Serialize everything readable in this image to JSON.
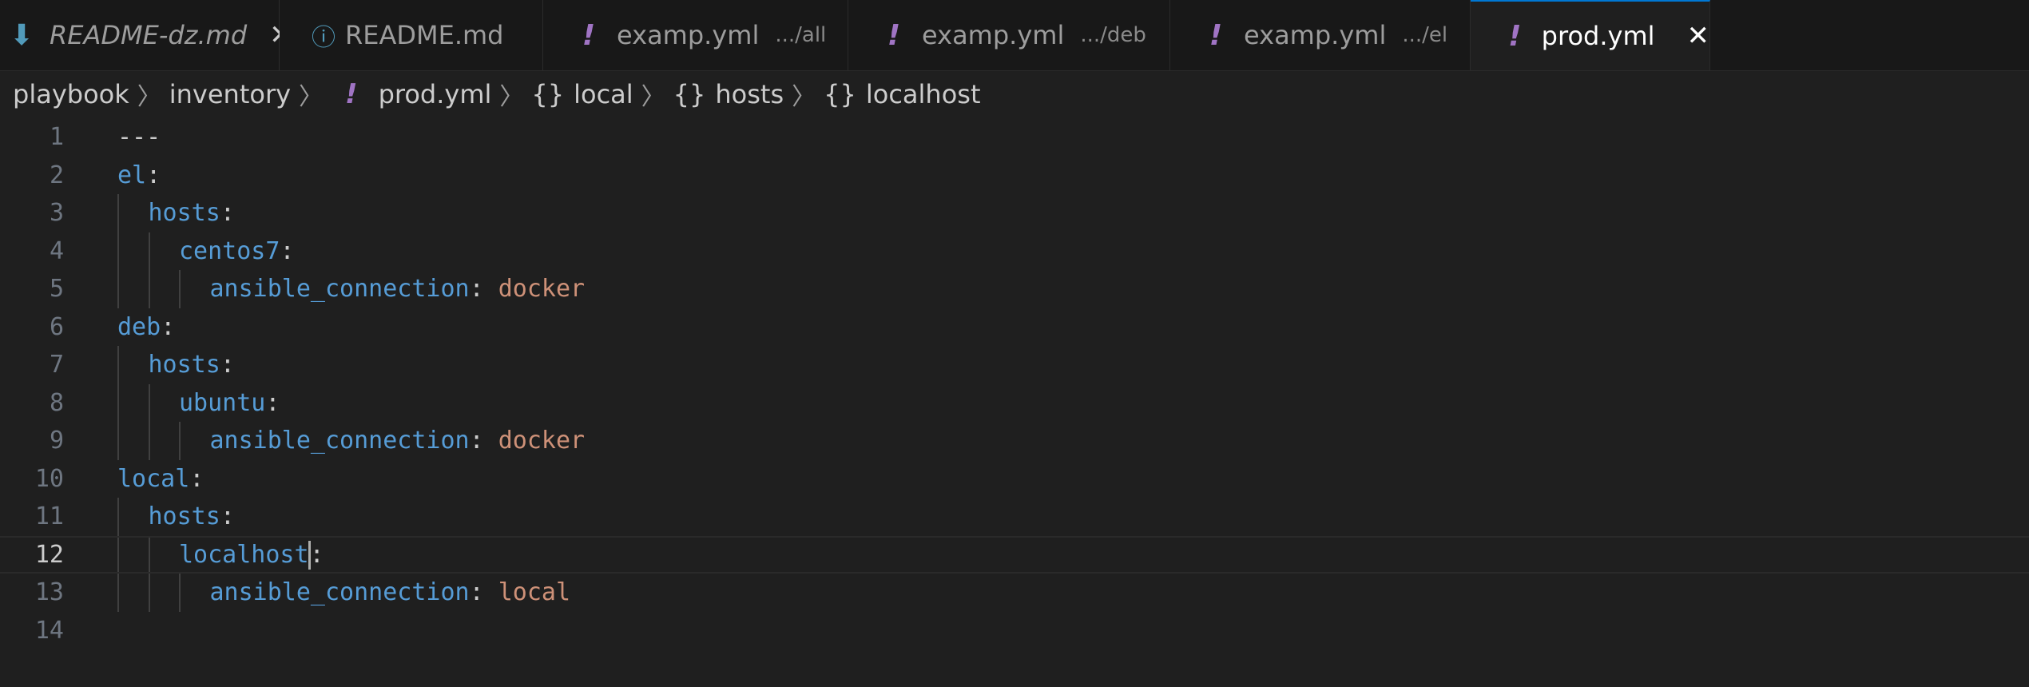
{
  "tabs": [
    {
      "icon": "markdown-download-icon",
      "glyph": "⬇",
      "label": "README-dz.md",
      "desc": "",
      "close": "✕"
    },
    {
      "icon": "info-icon",
      "glyph": "ⓘ",
      "label": "README.md",
      "desc": "",
      "close": ""
    },
    {
      "icon": "yaml-icon",
      "glyph": "!",
      "label": "examp.yml",
      "desc": ".../all",
      "close": ""
    },
    {
      "icon": "yaml-icon",
      "glyph": "!",
      "label": "examp.yml",
      "desc": ".../deb",
      "close": ""
    },
    {
      "icon": "yaml-icon",
      "glyph": "!",
      "label": "examp.yml",
      "desc": ".../el",
      "close": ""
    },
    {
      "icon": "yaml-icon",
      "glyph": "!",
      "label": "prod.yml",
      "desc": "",
      "close": "✕"
    }
  ],
  "breadcrumb": {
    "items": [
      "playbook",
      "inventory",
      "prod.yml",
      "local",
      "hosts",
      "localhost"
    ],
    "yml_glyph": "!",
    "obj_glyph": "{}",
    "sep_glyph": "〉"
  },
  "editor": {
    "current_line": 12,
    "lines": [
      {
        "n": "1",
        "indent": 0,
        "tokens": [
          {
            "t": "---",
            "c": "p"
          }
        ]
      },
      {
        "n": "2",
        "indent": 0,
        "tokens": [
          {
            "t": "el",
            "c": "k"
          },
          {
            "t": ":",
            "c": "p"
          }
        ]
      },
      {
        "n": "3",
        "indent": 1,
        "tokens": [
          {
            "t": "hosts",
            "c": "k"
          },
          {
            "t": ":",
            "c": "p"
          }
        ]
      },
      {
        "n": "4",
        "indent": 2,
        "tokens": [
          {
            "t": "centos7",
            "c": "k"
          },
          {
            "t": ":",
            "c": "p"
          }
        ]
      },
      {
        "n": "5",
        "indent": 3,
        "tokens": [
          {
            "t": "ansible_connection",
            "c": "k"
          },
          {
            "t": ": ",
            "c": "p"
          },
          {
            "t": "docker",
            "c": "s"
          }
        ]
      },
      {
        "n": "6",
        "indent": 0,
        "tokens": [
          {
            "t": "deb",
            "c": "k"
          },
          {
            "t": ":",
            "c": "p"
          }
        ]
      },
      {
        "n": "7",
        "indent": 1,
        "tokens": [
          {
            "t": "hosts",
            "c": "k"
          },
          {
            "t": ":",
            "c": "p"
          }
        ]
      },
      {
        "n": "8",
        "indent": 2,
        "tokens": [
          {
            "t": "ubuntu",
            "c": "k"
          },
          {
            "t": ":",
            "c": "p"
          }
        ]
      },
      {
        "n": "9",
        "indent": 3,
        "tokens": [
          {
            "t": "ansible_connection",
            "c": "k"
          },
          {
            "t": ": ",
            "c": "p"
          },
          {
            "t": "docker",
            "c": "s"
          }
        ]
      },
      {
        "n": "10",
        "indent": 0,
        "tokens": [
          {
            "t": "local",
            "c": "k"
          },
          {
            "t": ":",
            "c": "p"
          }
        ]
      },
      {
        "n": "11",
        "indent": 1,
        "tokens": [
          {
            "t": "hosts",
            "c": "k"
          },
          {
            "t": ":",
            "c": "p"
          }
        ]
      },
      {
        "n": "12",
        "indent": 2,
        "tokens": [
          {
            "t": "localhost",
            "c": "k"
          },
          {
            "t": ":",
            "c": "p"
          }
        ]
      },
      {
        "n": "13",
        "indent": 3,
        "tokens": [
          {
            "t": "ansible_connection",
            "c": "k"
          },
          {
            "t": ": ",
            "c": "p"
          },
          {
            "t": "local",
            "c": "s"
          }
        ]
      },
      {
        "n": "14",
        "indent": 0,
        "tokens": []
      }
    ]
  },
  "colors": {
    "background": "#1f1f1f",
    "tabbar": "#181818",
    "key": "#569cd6",
    "string": "#ce9178",
    "yaml_icon": "#a074c4",
    "md_icon": "#519aba",
    "active_tab_border": "#0078d4"
  }
}
